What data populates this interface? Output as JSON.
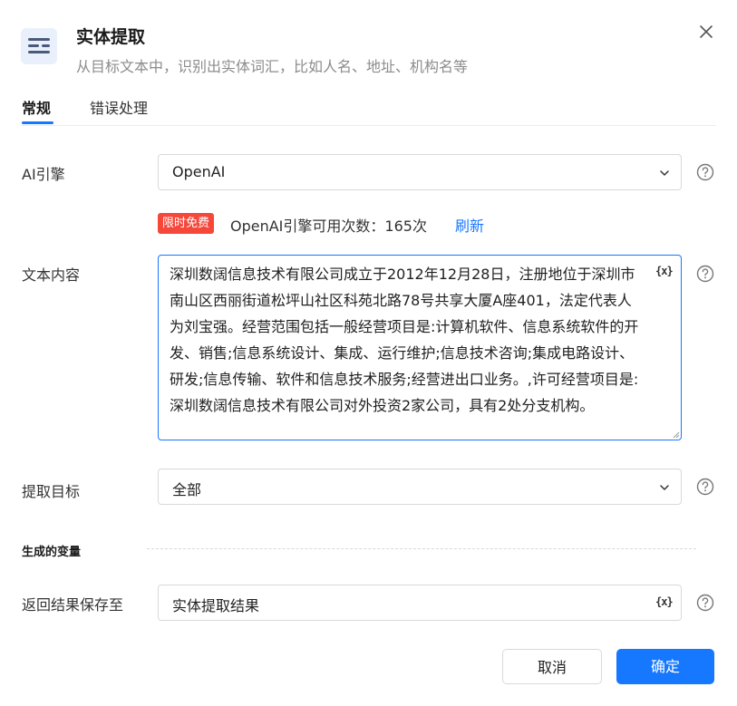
{
  "header": {
    "title": "实体提取",
    "subtitle": "从目标文本中，识别出实体词汇，比如人名、地址、机构名等",
    "icon": "entity-extract-icon"
  },
  "tabs": [
    {
      "label": "常规",
      "active": true
    },
    {
      "label": "错误处理",
      "active": false
    }
  ],
  "fields": {
    "ai_engine": {
      "label": "AI引擎",
      "value": "OpenAI"
    },
    "quota": {
      "badge": "限时免费",
      "text": "OpenAI引擎可用次数：165次",
      "refresh": "刷新"
    },
    "text_content": {
      "label": "文本内容",
      "value": "深圳数阔信息技术有限公司成立于2012年12月28日，注册地位于深圳市南山区西丽街道松坪山社区科苑北路78号共享大厦A座401，法定代表人为刘宝强。经营范围包括一般经营项目是:计算机软件、信息系统软件的开发、销售;信息系统设计、集成、运行维护;信息技术咨询;集成电路设计、研发;信息传输、软件和信息技术服务;经营进出口业务。,许可经营项目是:深圳数阔信息技术有限公司对外投资2家公司，具有2处分支机构。"
    },
    "extract_target": {
      "label": "提取目标",
      "value": "全部"
    }
  },
  "variables": {
    "section_title": "生成的变量",
    "save_to": {
      "label": "返回结果保存至",
      "value": "实体提取结果"
    }
  },
  "var_button_label": "{x}",
  "footer": {
    "cancel": "取消",
    "confirm": "确定"
  },
  "colors": {
    "primary": "#1677ff",
    "badge": "#f5483b"
  }
}
